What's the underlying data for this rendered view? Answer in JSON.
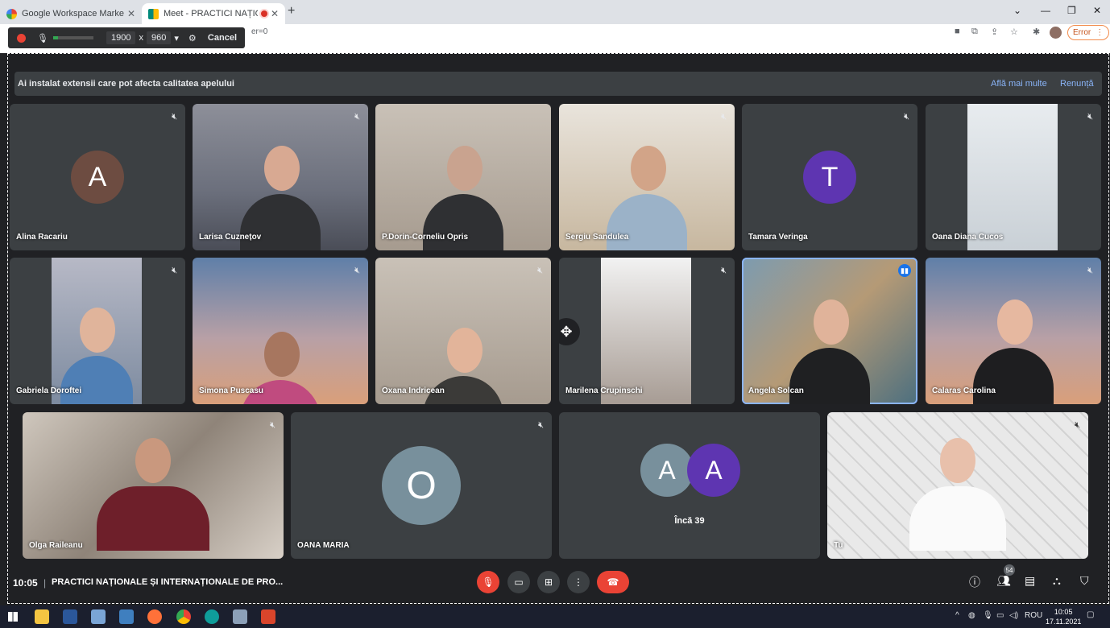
{
  "browser": {
    "tabs": [
      {
        "label": "Google Workspace Marketplace",
        "favicon_color": "#4285f4"
      },
      {
        "label": "Meet - PRACTICI NAȚIONALE",
        "favicon_color": "#00897b"
      }
    ],
    "address_fragment": "er=0",
    "error_label": "Error"
  },
  "recorder": {
    "width": "1900",
    "x": "x",
    "height": "960",
    "cancel_label": "Cancel"
  },
  "banner": {
    "text": "Ai instalat extensii care pot afecta calitatea apelului",
    "learn_more": "Află mai multe",
    "dismiss": "Renunță"
  },
  "participants": [
    {
      "name": "Alina Racariu",
      "initial": "A",
      "avatar_color": "#6d4c41"
    },
    {
      "name": "Larisa Cuznețov"
    },
    {
      "name": "P.Dorin-Corneliu Opris"
    },
    {
      "name": "Sergiu Sandulea"
    },
    {
      "name": "Tamara Veringa",
      "initial": "T",
      "avatar_color": "#5e35b1"
    },
    {
      "name": "Oana Diana Cucos"
    },
    {
      "name": "Gabriela Doroftei"
    },
    {
      "name": "Simona Puscasu"
    },
    {
      "name": "Oxana Indricean"
    },
    {
      "name": "Marilena Crupinschi"
    },
    {
      "name": "Angela Solcan"
    },
    {
      "name": "Calaras Carolina"
    },
    {
      "name": "Olga Raileanu"
    },
    {
      "name": "OANA MARIA",
      "initial": "O",
      "avatar_color": "#78909c"
    },
    {
      "name": "Tu"
    }
  ],
  "more_tile": {
    "initials": [
      "A",
      "A"
    ],
    "colors": [
      "#78909c",
      "#5e35b1"
    ],
    "label": "Încă 39"
  },
  "bottom_bar": {
    "time": "10:05",
    "meeting_title": "PRACTICI NAȚIONALE ȘI INTERNAȚIONALE DE PRO...",
    "people_count": "54"
  },
  "taskbar": {
    "language": "ROU",
    "time": "10:05",
    "date": "17.11.2021"
  }
}
